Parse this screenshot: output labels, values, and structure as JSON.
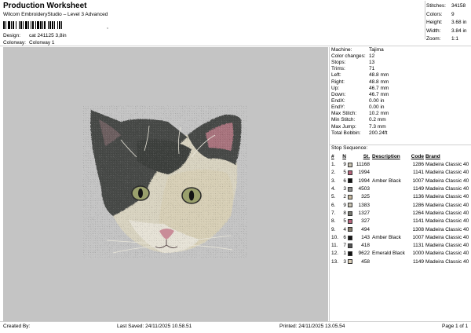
{
  "header": {
    "title": "Production Worksheet",
    "subtitle": "Wilcom EmbroideryStudio – Level 3 Advanced",
    "barcode_mark": ",",
    "design_label": "Design:",
    "design_value": "cat 241125 3,8in",
    "colorway_label": "Colorway:",
    "colorway_value": "Colorway 1"
  },
  "stats": [
    {
      "label": "Stitches:",
      "value": "34158"
    },
    {
      "label": "Colors:",
      "value": "9"
    },
    {
      "label": "Height:",
      "value": "3.68 in"
    },
    {
      "label": "Width:",
      "value": "3.84 in"
    },
    {
      "label": "Zoom:",
      "value": "1:1"
    }
  ],
  "machine_info": [
    {
      "label": "Machine:",
      "value": "Tajima"
    },
    {
      "label": "Color changes:",
      "value": "12"
    },
    {
      "label": "Stops:",
      "value": "13"
    },
    {
      "label": "Trims:",
      "value": "71"
    },
    {
      "label": "Left:",
      "value": "48.8 mm"
    },
    {
      "label": "Right:",
      "value": "48.8 mm"
    },
    {
      "label": "Up:",
      "value": "46.7 mm"
    },
    {
      "label": "Down:",
      "value": "46.7 mm"
    },
    {
      "label": "EndX:",
      "value": "0.00 in"
    },
    {
      "label": "EndY:",
      "value": "0.00 in"
    },
    {
      "label": "Max Stitch:",
      "value": "10.2 mm"
    },
    {
      "label": "Min Stitch:",
      "value": "0.2 mm"
    },
    {
      "label": "Max Jump:",
      "value": "7.3 mm"
    },
    {
      "label": "Total Bobbin:",
      "value": "200.24ft"
    }
  ],
  "stop_sequence": {
    "title": "Stop Sequence:",
    "headers": {
      "num": "#",
      "n": "N",
      "st": "St.",
      "description": "Description",
      "code": "Code",
      "brand": "Brand"
    },
    "rows": [
      {
        "num": "1.",
        "stop": "9",
        "color": "#c9c3b2",
        "st": "11168",
        "description": "",
        "code": "1286",
        "brand": "Madeira Classic 40"
      },
      {
        "num": "2.",
        "stop": "5",
        "color": "#b6657c",
        "st": "1994",
        "description": "",
        "code": "1141",
        "brand": "Madeira Classic 40"
      },
      {
        "num": "3.",
        "stop": "6",
        "color": "#141414",
        "st": "1994",
        "description": "Amber Black",
        "code": "1007",
        "brand": "Madeira Classic 40"
      },
      {
        "num": "4.",
        "stop": "3",
        "color": "#8e8e8c",
        "st": "4503",
        "description": "",
        "code": "1149",
        "brand": "Madeira Classic 40"
      },
      {
        "num": "5.",
        "stop": "2",
        "color": "#c6b99f",
        "st": "325",
        "description": "",
        "code": "1136",
        "brand": "Madeira Classic 40"
      },
      {
        "num": "6.",
        "stop": "9",
        "color": "#c9c3b2",
        "st": "1383",
        "description": "",
        "code": "1286",
        "brand": "Madeira Classic 40"
      },
      {
        "num": "7.",
        "stop": "8",
        "color": "#77776f",
        "st": "1327",
        "description": "",
        "code": "1264",
        "brand": "Madeira Classic 40"
      },
      {
        "num": "8.",
        "stop": "5",
        "color": "#b6657c",
        "st": "327",
        "description": "",
        "code": "1141",
        "brand": "Madeira Classic 40"
      },
      {
        "num": "9.",
        "stop": "4",
        "color": "#8a8170",
        "st": "494",
        "description": "",
        "code": "1308",
        "brand": "Madeira Classic 40"
      },
      {
        "num": "10.",
        "stop": "6",
        "color": "#141414",
        "st": "143",
        "description": "Amber Black",
        "code": "1007",
        "brand": "Madeira Classic 40"
      },
      {
        "num": "11.",
        "stop": "7",
        "color": "#545454",
        "st": "418",
        "description": "",
        "code": "1131",
        "brand": "Madeira Classic 40"
      },
      {
        "num": "12.",
        "stop": "1",
        "color": "#111111",
        "st": "9622",
        "description": "Emerald Black",
        "code": "1000",
        "brand": "Madeira Classic 40"
      },
      {
        "num": "13.",
        "stop": "3",
        "color": "#d9cdb7",
        "st": "458",
        "description": "",
        "code": "1149",
        "brand": "Madeira Classic 40"
      }
    ]
  },
  "footer": {
    "created_by": "Created By:",
    "last_saved": "Last Saved: 24/11/2025 10.58.51",
    "printed": "Printed: 24/11/2025 13.05.54",
    "page": "Page 1 of 1"
  },
  "colors": {
    "design_background": "#c4c4c4",
    "fur_dark": "#474847",
    "fur_light": "#d8d3c0",
    "eye": "#9aa06c",
    "nose": "#c98c98"
  },
  "icons": {
    "design_preview": "cat-embroidery-preview",
    "barcode": "barcode-icon"
  }
}
